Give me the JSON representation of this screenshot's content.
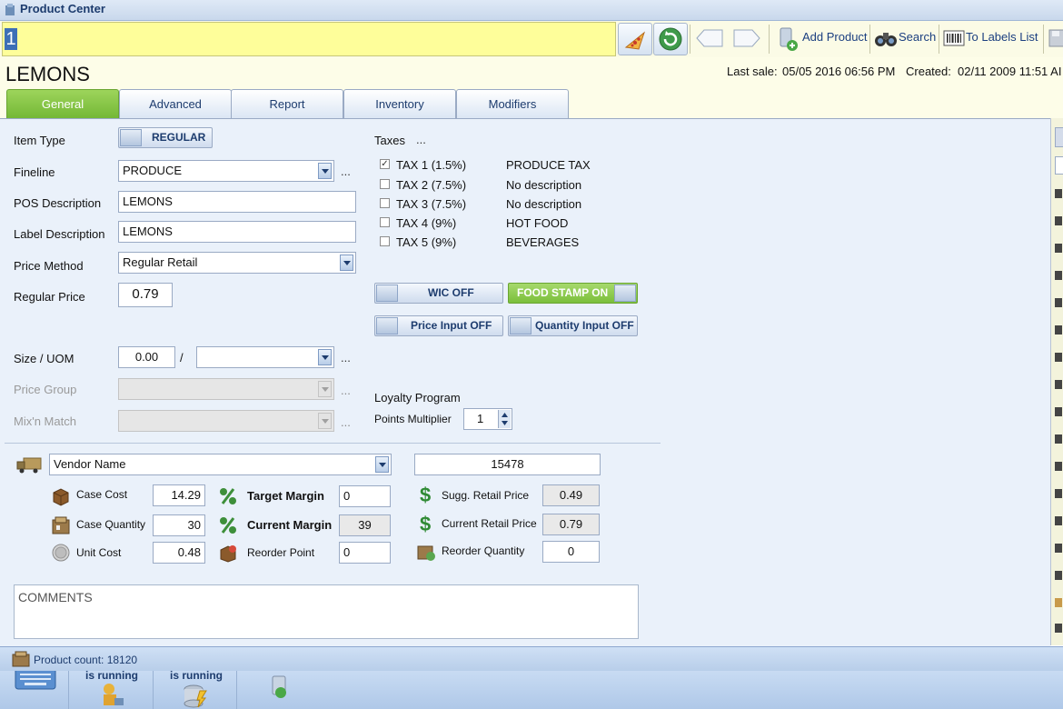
{
  "window": {
    "title": "Product Center"
  },
  "toolbar": {
    "scan_value": "1",
    "add_product": "Add Product",
    "search": "Search",
    "to_labels_list": "To Labels List"
  },
  "header": {
    "product_name": "LEMONS",
    "last_sale_label": "Last sale:",
    "last_sale_value": "05/05 2016 06:56 PM",
    "created_label": "Created:",
    "created_value": "02/11 2009 11:51 AI"
  },
  "tabs": [
    "General",
    "Advanced",
    "Report",
    "Inventory",
    "Modifiers"
  ],
  "general": {
    "item_type_label": "Item Type",
    "item_type_value": "REGULAR",
    "fineline_label": "Fineline",
    "fineline_value": "PRODUCE",
    "pos_desc_label": "POS Description",
    "pos_desc_value": "LEMONS",
    "label_desc_label": "Label Description",
    "label_desc_value": "LEMONS",
    "price_method_label": "Price Method",
    "price_method_value": "Regular Retail",
    "regular_price_label": "Regular Price",
    "regular_price_value": "0.79",
    "size_uom_label": "Size / UOM",
    "size_value": "0.00",
    "size_sep": "/",
    "price_group_label": "Price Group",
    "mix_match_label": "Mix'n Match",
    "ellipsis": "..."
  },
  "taxes": {
    "title": "Taxes",
    "ellipsis": "...",
    "items": [
      {
        "name": "TAX 1 (1.5%)",
        "desc": "PRODUCE TAX",
        "checked": true
      },
      {
        "name": "TAX 2 (7.5%)",
        "desc": "No description",
        "checked": false
      },
      {
        "name": "TAX 3 (7.5%)",
        "desc": "No description",
        "checked": false
      },
      {
        "name": "TAX 4 (9%)",
        "desc": "HOT FOOD",
        "checked": false
      },
      {
        "name": "TAX 5 (9%)",
        "desc": "BEVERAGES",
        "checked": false
      }
    ]
  },
  "toggles": {
    "wic": "WIC OFF",
    "food_stamp": "FOOD STAMP ON",
    "price_input": "Price Input OFF",
    "quantity_input": "Quantity Input OFF"
  },
  "loyalty": {
    "title": "Loyalty Program",
    "points_label": "Points Multiplier",
    "points_value": "1"
  },
  "vendor": {
    "name_label": "Vendor Name",
    "code": "15478",
    "case_cost_label": "Case Cost",
    "case_cost_value": "14.29",
    "case_qty_label": "Case Quantity",
    "case_qty_value": "30",
    "unit_cost_label": "Unit Cost",
    "unit_cost_value": "0.48",
    "target_margin_label": "Target Margin",
    "target_margin_value": "0",
    "current_margin_label": "Current Margin",
    "current_margin_value": "39",
    "reorder_point_label": "Reorder Point",
    "reorder_point_value": "0",
    "sugg_retail_label": "Sugg. Retail Price",
    "sugg_retail_value": "0.49",
    "current_retail_label": "Current Retail Price",
    "current_retail_value": "0.79",
    "reorder_qty_label": "Reorder Quantity",
    "reorder_qty_value": "0"
  },
  "comments": {
    "placeholder": "COMMENTS"
  },
  "status": {
    "product_count": "Product count: 18120"
  },
  "taskbar": {
    "item1": "is running",
    "item2": "is running"
  }
}
